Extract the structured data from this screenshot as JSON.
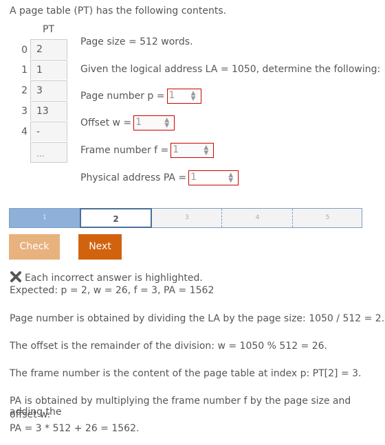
{
  "intro": "A page table (PT) has the following contents.",
  "page_table": {
    "title": "PT",
    "rows": [
      {
        "index": "0",
        "value": "2"
      },
      {
        "index": "1",
        "value": "1"
      },
      {
        "index": "2",
        "value": "3"
      },
      {
        "index": "3",
        "value": "13"
      },
      {
        "index": "4",
        "value": "-"
      }
    ],
    "ellipsis": "..."
  },
  "questions": {
    "page_size": "Page size = 512 words.",
    "given": "Given the logical address LA = 1050, determine the following:",
    "page_number_label": "Page number p =",
    "page_number_value": "1",
    "offset_label": "Offset w =",
    "offset_value": "1",
    "frame_label": "Frame number f =",
    "frame_value": "1",
    "pa_label": "Physical address PA =",
    "pa_value": "1"
  },
  "progress": {
    "steps": [
      "1",
      "2",
      "3",
      "4",
      "5"
    ],
    "current": 2
  },
  "buttons": {
    "check": "Check",
    "next": "Next"
  },
  "feedback": {
    "incorrect": "Each incorrect answer is highlighted.",
    "expected": "Expected: p = 2, w = 26, f = 3, PA = 1562",
    "exp1": "Page number is obtained by dividing the LA by the page size: 1050 / 512 = 2.",
    "exp2": "The offset is the remainder of the division: w = 1050 % 512 = 26.",
    "exp3": "The frame number is the content of the page table at index p: PT[2] = 3.",
    "exp4a": "PA is obtained by multiplying the frame number f by the page size and adding the",
    "exp4b": "offset w:",
    "exp4c": "PA = 3 * 512 + 26 = 1562."
  },
  "colors": {
    "error_border": "#cc0000",
    "check_btn": "#e8b27f",
    "next_btn": "#d2630e",
    "progress_done": "#8fb0d8"
  }
}
